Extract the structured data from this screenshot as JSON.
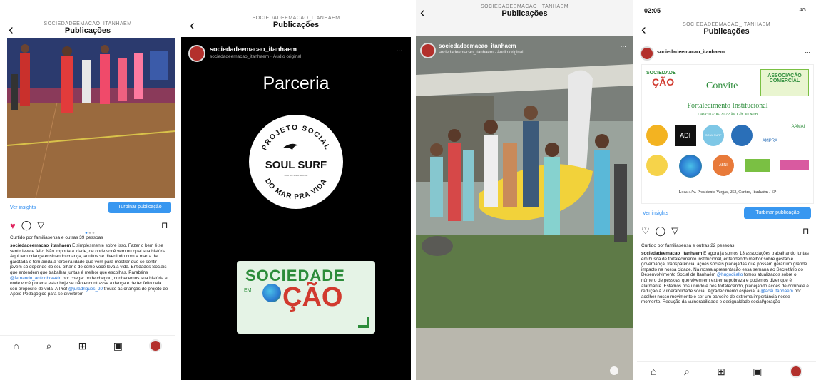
{
  "panels": [
    {
      "account": "SOCIEDADEEMACAO_ITANHAEM",
      "title": "Publicações",
      "insights": "Ver insights",
      "boost": "Turbinar publicação",
      "liked_by": "Curtido por familiasensa e outras 39 pessoas",
      "caption": {
        "user": "sociedadeemacao_itanhaem",
        "text": "É simplesmente sobre isso. Fazer o bem é se sentir leve e feliz. Não importa a idade, de onde você vem ou qual sua história. Aqui tem criança ensinando criança, adultos se divertindo com a marra da garotada e tem ainda a terceira idade que vem para mostrar que se sentir jovem só depende do seu olhar e de como você leva a vida. Entidades Sociais que entendem que trabalhar juntas é melhor que escolhas. Parabéns",
        "mention1": "@fernando_actionbreakin",
        "text2": "por chegar onde chegou, conhecemos sua história e onde você poderia estar hoje se não encontrasse a dança e de ter feito dela seu propósito de vida. A Prof",
        "mention2": "@juradrigues_20",
        "text3": "trouxe as crianças do projeto de Apoio Pedagógico para se divertirem"
      }
    },
    {
      "account": "SOCIEDADEEMACAO_ITANHAEM",
      "title": "Publicações",
      "reel_user": "sociedadeemacao_itanhaem",
      "reel_audio": "sociedadeemacao_itanhaem · Áudio original",
      "more": "...",
      "headline": "Parceria",
      "badge_top": "PROJETO SOCIAL",
      "badge_mid": "SOUL SURF",
      "badge_small": "ECO DO SURF SOCIAL",
      "badge_bottom": "DO MAR PRA VIDA",
      "logo_top": "SOCIEDADE",
      "logo_em": "EM",
      "logo_bottom": "ÇÃO"
    },
    {
      "account": "SOCIEDADEEMACAO_ITANHAEM",
      "title": "Publicações",
      "reel_user": "sociedadeemacao_itanhaem",
      "reel_audio": "sociedadeemacao_itanhaem · Áudio original",
      "more": "..."
    },
    {
      "status_time": "02:05",
      "status_right": "4G",
      "account": "SOCIEDADEEMACAO_ITANHAEM",
      "title": "Publicações",
      "post_user": "sociedadeemacao_itanhaem",
      "more": "...",
      "flyer": {
        "logo_left_top": "SOCIEDADE",
        "logo_left_bottom": "ÇÃO",
        "convite": "Convite",
        "logo_right_1": "ASSOCIAÇÃO",
        "logo_right_2": "COMERCIAL",
        "heading": "Fortalecimento Institucional",
        "date": "Data: 02/06/2022 às 17h 30 Min",
        "partners": [
          "ADI",
          "SOUL SURF",
          "AMPRA",
          "AAMAI",
          "ABNI"
        ],
        "local": "Local: Av. Presidente Vargas, 252, Centro, Itanhaém / SP"
      },
      "insights": "Ver insights",
      "boost": "Turbinar publicação",
      "liked_by": "Curtido por familiasensa e outras 22 pessoas",
      "caption": {
        "user": "sociedadeemacao_itanhaem",
        "text": "E agora já somos 13 associações trabalhando juntas em busca de fortalecimento institucional, entendendo melhor sobre gestão e governança, transparência, ações sociais planejadas que possam gerar um grande impacto na nossa cidade. Na nossa apresentação essa semana ao Secretário do Desenvolvimento Social de Itanhaém",
        "mention1": "@hugodilallo",
        "text2": "fomos atualizados sobre o número de pessoas que vivem em extrema pobreza e podemos dizer que é alarmante. Estamos nos unindo e nos fortalecendo, planejando ações de combate e redução à vulnerabilidade social. Agradecimento especial a",
        "mention2": "@acai.itanhaem",
        "text3": "por acolher nosso movimento e ser um parceiro de extrema importância nesse momento. Redução da vulnerabilidade e desigualdade social/geração"
      }
    }
  ]
}
